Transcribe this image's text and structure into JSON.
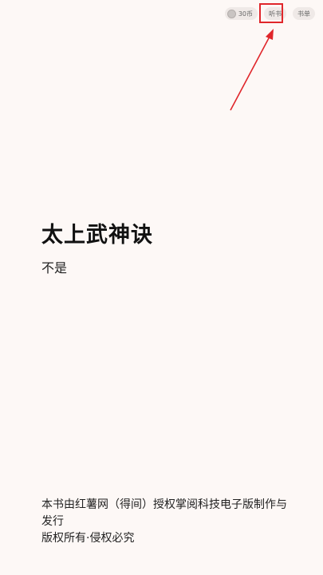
{
  "top_bar": {
    "coins_label": "30币",
    "listen_label": "听书",
    "list_label": "书单"
  },
  "book": {
    "title": "太上武神诀",
    "author": "不是"
  },
  "copyright": {
    "line1": "本书由红薯网（得间）授权掌阅科技电子版制作与发行",
    "line2": "版权所有·侵权必究"
  },
  "colors": {
    "background": "#fdf8f6",
    "highlight": "#e0262b"
  }
}
